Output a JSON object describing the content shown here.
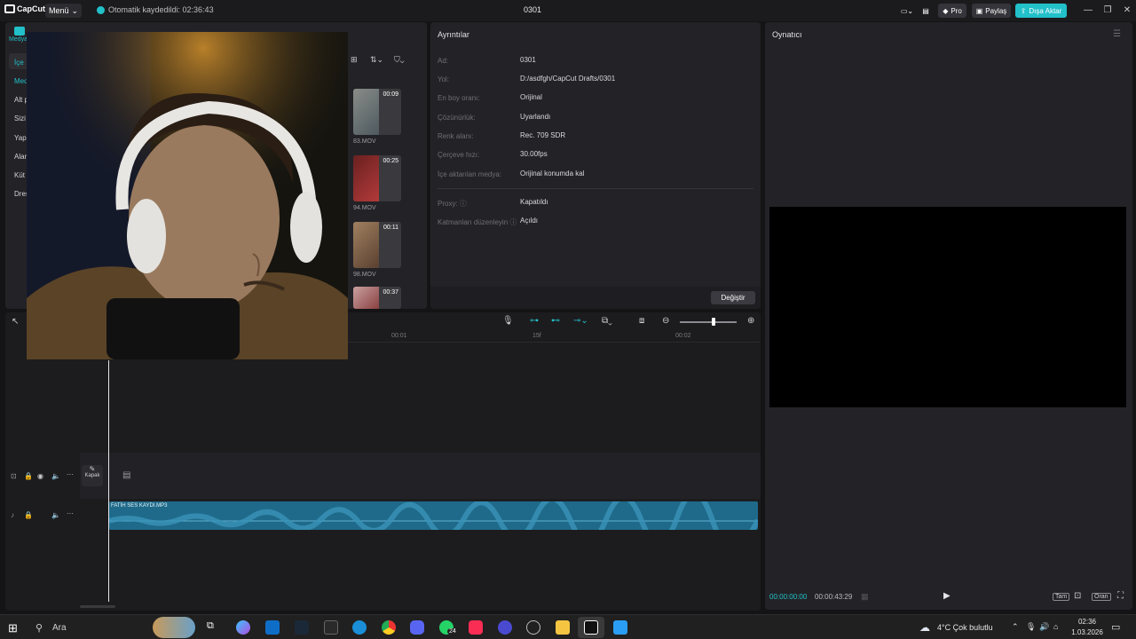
{
  "titlebar": {
    "logo_text": "CapCut",
    "menu_label": "Menü",
    "autosave_text": "Otomatik kaydedildi: 02:36:43",
    "project_title": "0301",
    "pro_label": "Pro",
    "share_label": "Paylaş",
    "export_label": "Dışa Aktar",
    "accent_color": "#22c0c9"
  },
  "media_panel": {
    "active_tab_label": "Medya",
    "sidebar_items": [
      "İçe",
      "Med",
      "Alt p",
      "Sizi",
      "Yap",
      "Alar",
      "Küt",
      "Dres"
    ],
    "clips": [
      {
        "duration": "00:09",
        "name": "83.MOV"
      },
      {
        "duration": "00:25",
        "name": "94.MOV"
      },
      {
        "duration": "00:11",
        "name": "98.MOV"
      },
      {
        "duration": "00:37",
        "name": ""
      }
    ]
  },
  "details": {
    "title": "Ayrıntılar",
    "rows": [
      {
        "label": "Ad:",
        "value": "0301"
      },
      {
        "label": "Yol:",
        "value": "D:/asdfgh/CapCut Drafts/0301"
      },
      {
        "label": "En boy oranı:",
        "value": "Orijinal"
      },
      {
        "label": "Çözünürlük:",
        "value": "Uyarlandı"
      },
      {
        "label": "Renk alanı:",
        "value": "Rec. 709 SDR"
      },
      {
        "label": "Çerçeve hızı:",
        "value": "30.00fps"
      },
      {
        "label": "İçe aktarılan medya:",
        "value": "Orijinal konumda kal"
      }
    ],
    "rows2": [
      {
        "label": "Proxy:",
        "value": "Kapatıldı"
      },
      {
        "label": "Katmanları düzenleyin",
        "value": "Açıldı"
      }
    ],
    "change_button": "Değiştir"
  },
  "player": {
    "title": "Oynatıcı",
    "current_time": "00:00:00:00",
    "total_time": "00:00:43:29",
    "full_label": "Tam",
    "ratio_label": "Oran"
  },
  "timeline": {
    "ruler": [
      "00:01",
      "15f",
      "00:02"
    ],
    "cover_label": "Kapak",
    "audio_clip_name": "FATİH SES KAYDI.MP3",
    "audio_color": "#1f6a8a"
  },
  "taskbar": {
    "search_placeholder": "Ara",
    "weather": "4°C  Çok bulutlu",
    "clock_time": "02:36",
    "clock_date": "1.03.2026",
    "whatsapp_badge": "24"
  }
}
